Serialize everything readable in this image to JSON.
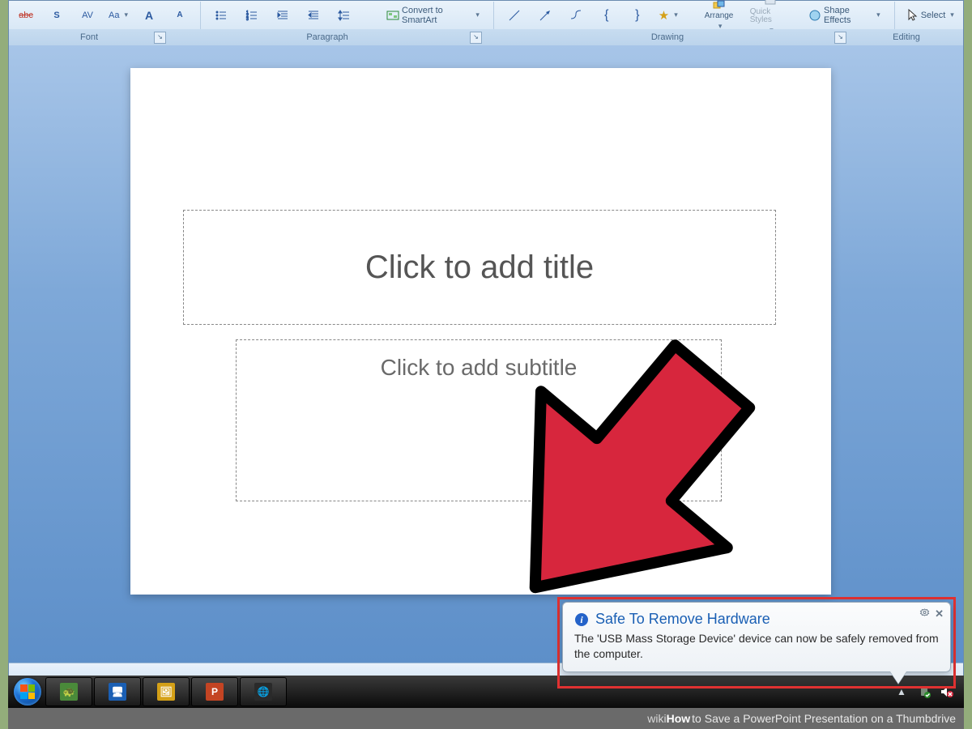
{
  "ribbon": {
    "font_group_label": "Font",
    "paragraph_group_label": "Paragraph",
    "drawing_group_label": "Drawing",
    "editing_group_label": "Editing",
    "convert_smartart": "Convert to SmartArt",
    "arrange": "Arrange",
    "quick_styles": "Quick Styles",
    "shape_effects": "Shape Effects",
    "select": "Select",
    "font_size_grow": "A",
    "font_size_shrink": "A",
    "change_case": "Aa",
    "strike": "abc"
  },
  "slide": {
    "title_placeholder": "Click to add title",
    "subtitle_placeholder": "Click to add subtitle"
  },
  "notification": {
    "title": "Safe To Remove Hardware",
    "body": "The 'USB Mass Storage Device' device can now be safely removed from the computer."
  },
  "caption": {
    "wiki": "wiki",
    "how": "How",
    "rest": " to Save a PowerPoint Presentation on a Thumbdrive"
  }
}
